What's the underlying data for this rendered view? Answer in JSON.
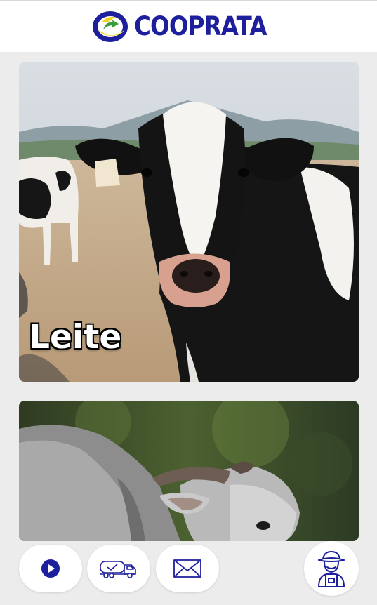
{
  "header": {
    "brand_name": "COOPRATA",
    "brand_color": "#1d1f9c"
  },
  "feed": {
    "cards": [
      {
        "label": "Leite",
        "image": "holstein-cow-photo"
      },
      {
        "label": "",
        "image": "zebu-bull-photo"
      }
    ]
  },
  "bottom_nav": {
    "buttons": [
      {
        "icon": "play-icon"
      },
      {
        "icon": "milk-truck-icon"
      },
      {
        "icon": "mail-icon"
      },
      {
        "icon": "farmer-icon"
      }
    ],
    "accent_color": "#1d1f9c"
  }
}
